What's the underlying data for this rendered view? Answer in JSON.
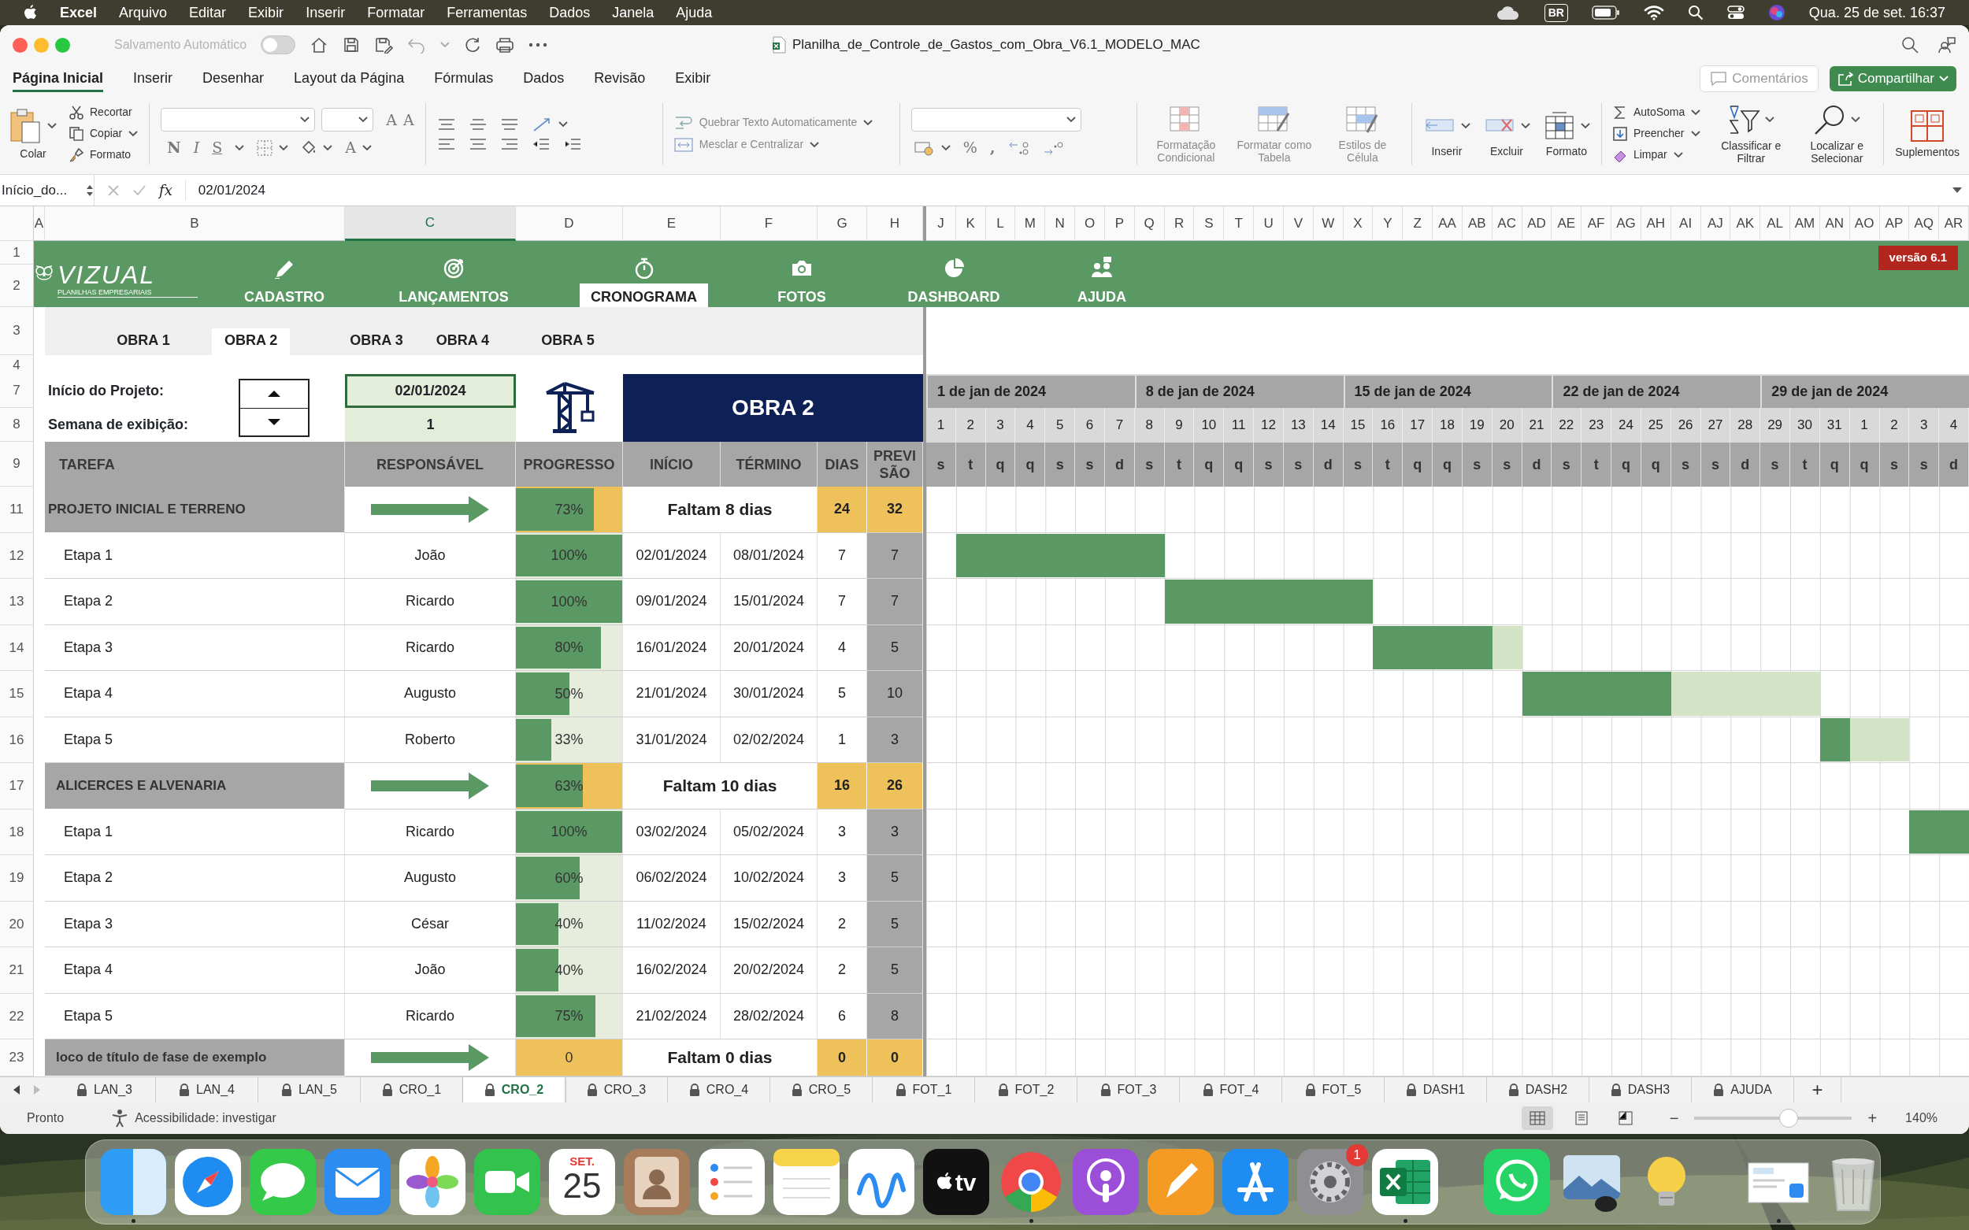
{
  "menu_bar": {
    "app": "Excel",
    "menus": [
      "Arquivo",
      "Editar",
      "Exibir",
      "Inserir",
      "Formatar",
      "Ferramentas",
      "Dados",
      "Janela",
      "Ajuda"
    ],
    "input_source": "BR",
    "clock": "Qua. 25 de set.  16:37"
  },
  "window": {
    "autosave_label": "Salvamento Automático",
    "autosave_on": false,
    "title": "Planilha_de_Controle_de_Gastos_com_Obra_V6.1_MODELO_MAC"
  },
  "ribbon_tabs": [
    {
      "label": "Página Inicial",
      "selected": true
    },
    {
      "label": "Inserir",
      "selected": false
    },
    {
      "label": "Desenhar",
      "selected": false
    },
    {
      "label": "Layout da Página",
      "selected": false
    },
    {
      "label": "Fórmulas",
      "selected": false
    },
    {
      "label": "Dados",
      "selected": false
    },
    {
      "label": "Revisão",
      "selected": false
    },
    {
      "label": "Exibir",
      "selected": false
    }
  ],
  "comments_button": "Comentários",
  "share_button": "Compartilhar",
  "ribbon": {
    "paste": "Colar",
    "cut": "Recortar",
    "copy": "Copiar",
    "format_painter": "Formato",
    "grow_font": "A",
    "shrink_font": "A",
    "bold": "N",
    "italic": "I",
    "underline": "S",
    "font_color": "A",
    "wrap_text": "Quebrar Texto Automaticamente",
    "merge": "Mesclar e Centralizar",
    "percent": "%",
    "comma": ",",
    "styles": [
      "Formatação Condicional",
      "Formatar como Tabela",
      "Estilos de Célula"
    ],
    "cells": [
      "Inserir",
      "Excluir",
      "Formato"
    ],
    "autosum": "AutoSoma",
    "fill": "Preencher",
    "clear": "Limpar",
    "sort": "Classificar e Filtrar",
    "find": "Localizar e Selecionar",
    "addins": "Suplementos"
  },
  "formula_bar": {
    "name_box": "Início_do...",
    "fx": "fx",
    "value": "02/01/2024"
  },
  "columns": [
    {
      "label": "A",
      "selected": false
    },
    {
      "label": "B",
      "selected": false
    },
    {
      "label": "C",
      "selected": true
    },
    {
      "label": "D",
      "selected": false
    },
    {
      "label": "E",
      "selected": false
    },
    {
      "label": "F",
      "selected": false
    },
    {
      "label": "G",
      "selected": false
    },
    {
      "label": "H",
      "selected": false
    },
    {
      "label": "J",
      "selected": false
    },
    {
      "label": "K",
      "selected": false
    },
    {
      "label": "L",
      "selected": false
    },
    {
      "label": "M",
      "selected": false
    },
    {
      "label": "N",
      "selected": false
    },
    {
      "label": "O",
      "selected": false
    },
    {
      "label": "P",
      "selected": false
    },
    {
      "label": "Q",
      "selected": false
    },
    {
      "label": "R",
      "selected": false
    },
    {
      "label": "S",
      "selected": false
    },
    {
      "label": "T",
      "selected": false
    },
    {
      "label": "U",
      "selected": false
    },
    {
      "label": "V",
      "selected": false
    },
    {
      "label": "W",
      "selected": false
    },
    {
      "label": "X",
      "selected": false
    },
    {
      "label": "Y",
      "selected": false
    },
    {
      "label": "Z",
      "selected": false
    },
    {
      "label": "AA",
      "selected": false
    },
    {
      "label": "AB",
      "selected": false
    },
    {
      "label": "AC",
      "selected": false
    },
    {
      "label": "AD",
      "selected": false
    },
    {
      "label": "AE",
      "selected": false
    },
    {
      "label": "AF",
      "selected": false
    },
    {
      "label": "AG",
      "selected": false
    },
    {
      "label": "AH",
      "selected": false
    },
    {
      "label": "AI",
      "selected": false
    },
    {
      "label": "AJ",
      "selected": false
    },
    {
      "label": "AK",
      "selected": false
    },
    {
      "label": "AL",
      "selected": false
    },
    {
      "label": "AM",
      "selected": false
    },
    {
      "label": "AN",
      "selected": false
    },
    {
      "label": "AO",
      "selected": false
    },
    {
      "label": "AP",
      "selected": false
    },
    {
      "label": "AQ",
      "selected": false
    },
    {
      "label": "AR",
      "selected": false
    }
  ],
  "row_numbers": [
    "1",
    "2",
    "3",
    "4",
    "7",
    "8",
    "9",
    "11",
    "12",
    "13",
    "14",
    "15",
    "16",
    "17",
    "18",
    "19",
    "20",
    "21",
    "22",
    "23"
  ],
  "nav": {
    "logo": "VIZUAL",
    "logo_sub": "PLANILHAS EMPRESARIAIS",
    "items": [
      {
        "label": "CADASTRO",
        "selected": false
      },
      {
        "label": "LANÇAMENTOS",
        "selected": false
      },
      {
        "label": "CRONOGRAMA",
        "selected": true
      },
      {
        "label": "FOTOS",
        "selected": false
      },
      {
        "label": "DASHBOARD",
        "selected": false
      },
      {
        "label": "AJUDA",
        "selected": false
      }
    ],
    "version": "versão 6.1"
  },
  "obra_tabs": [
    {
      "label": "OBRA 1",
      "selected": false
    },
    {
      "label": "OBRA 2",
      "selected": true
    },
    {
      "label": "OBRA 3",
      "selected": false
    },
    {
      "label": "OBRA 4",
      "selected": false
    },
    {
      "label": "OBRA 5",
      "selected": false
    }
  ],
  "project": {
    "start_label": "Início do Projeto:",
    "start": "02/01/2024",
    "week_label": "Semana de exibição:",
    "week": "1",
    "title": "OBRA 2"
  },
  "headers": [
    "TAREFA",
    "RESPONSÁVEL",
    "PROGRESSO",
    "INÍCIO",
    "TÉRMINO",
    "DIAS",
    "PREVISÃO"
  ],
  "timeline": {
    "weeks": [
      "1 de jan de 2024",
      "8 de jan de 2024",
      "15 de jan de 2024",
      "22 de jan de 2024",
      "29 de jan de 2024"
    ],
    "days": [
      "1",
      "2",
      "3",
      "4",
      "5",
      "6",
      "7",
      "8",
      "9",
      "10",
      "11",
      "12",
      "13",
      "14",
      "15",
      "16",
      "17",
      "18",
      "19",
      "20",
      "21",
      "22",
      "23",
      "24",
      "25",
      "26",
      "27",
      "28",
      "29",
      "30",
      "31",
      "1",
      "2",
      "3",
      "4"
    ],
    "weekdays": [
      "s",
      "t",
      "q",
      "q",
      "s",
      "s",
      "d",
      "s",
      "t",
      "q",
      "q",
      "s",
      "s",
      "d",
      "s",
      "t",
      "q",
      "q",
      "s",
      "s",
      "d",
      "s",
      "t",
      "q",
      "q",
      "s",
      "s",
      "d",
      "s",
      "t",
      "q",
      "q",
      "s",
      "s",
      "d"
    ]
  },
  "rows": [
    {
      "kind": "phase",
      "name": "PROJETO INICIAL E TERRENO",
      "level": 0.73,
      "progress": "73%",
      "remaining": "Faltam 8 dias",
      "days": "24",
      "forecast": "32"
    },
    {
      "kind": "task",
      "name": "Etapa 1",
      "owner": "João",
      "level": 1,
      "progress": "100%",
      "start": "02/01/2024",
      "end": "08/01/2024",
      "days": "7",
      "forecast": "7"
    },
    {
      "kind": "task",
      "name": "Etapa 2",
      "owner": "Ricardo",
      "level": 1,
      "progress": "100%",
      "start": "09/01/2024",
      "end": "15/01/2024",
      "days": "7",
      "forecast": "7"
    },
    {
      "kind": "task",
      "name": "Etapa 3",
      "owner": "Ricardo",
      "level": 0.8,
      "progress": "80%",
      "start": "16/01/2024",
      "end": "20/01/2024",
      "days": "4",
      "forecast": "5"
    },
    {
      "kind": "task",
      "name": "Etapa 4",
      "owner": "Augusto",
      "level": 0.5,
      "progress": "50%",
      "start": "21/01/2024",
      "end": "30/01/2024",
      "days": "5",
      "forecast": "10"
    },
    {
      "kind": "task",
      "name": "Etapa 5",
      "owner": "Roberto",
      "level": 0.33,
      "progress": "33%",
      "start": "31/01/2024",
      "end": "02/02/2024",
      "days": "1",
      "forecast": "3"
    },
    {
      "kind": "phase",
      "name": "ALICERCES E ALVENARIA",
      "level": 0.63,
      "progress": "63%",
      "remaining": "Faltam 10 dias",
      "days": "16",
      "forecast": "26"
    },
    {
      "kind": "task",
      "name": "Etapa 1",
      "owner": "Ricardo",
      "level": 1,
      "progress": "100%",
      "start": "03/02/2024",
      "end": "05/02/2024",
      "days": "3",
      "forecast": "3"
    },
    {
      "kind": "task",
      "name": "Etapa 2",
      "owner": "Augusto",
      "level": 0.6,
      "progress": "60%",
      "start": "06/02/2024",
      "end": "10/02/2024",
      "days": "3",
      "forecast": "5"
    },
    {
      "kind": "task",
      "name": "Etapa 3",
      "owner": "César",
      "level": 0.4,
      "progress": "40%",
      "start": "11/02/2024",
      "end": "15/02/2024",
      "days": "2",
      "forecast": "5"
    },
    {
      "kind": "task",
      "name": "Etapa 4",
      "owner": "João",
      "level": 0.4,
      "progress": "40%",
      "start": "16/02/2024",
      "end": "20/02/2024",
      "days": "2",
      "forecast": "5"
    },
    {
      "kind": "task",
      "name": "Etapa 5",
      "owner": "Ricardo",
      "level": 0.75,
      "progress": "75%",
      "start": "21/02/2024",
      "end": "28/02/2024",
      "days": "6",
      "forecast": "8"
    },
    {
      "kind": "phase",
      "name": "loco de título de fase de exemplo",
      "level": 0,
      "progress": "0",
      "remaining": "Faltam 0 dias",
      "days": "0",
      "forecast": "0"
    }
  ],
  "sheet_tabs": [
    {
      "label": "LAN_3",
      "selected": false
    },
    {
      "label": "LAN_4",
      "selected": false
    },
    {
      "label": "LAN_5",
      "selected": false
    },
    {
      "label": "CRO_1",
      "selected": false
    },
    {
      "label": "CRO_2",
      "selected": true
    },
    {
      "label": "CRO_3",
      "selected": false
    },
    {
      "label": "CRO_4",
      "selected": false
    },
    {
      "label": "CRO_5",
      "selected": false
    },
    {
      "label": "FOT_1",
      "selected": false
    },
    {
      "label": "FOT_2",
      "selected": false
    },
    {
      "label": "FOT_3",
      "selected": false
    },
    {
      "label": "FOT_4",
      "selected": false
    },
    {
      "label": "FOT_5",
      "selected": false
    },
    {
      "label": "DASH1",
      "selected": false
    },
    {
      "label": "DASH2",
      "selected": false
    },
    {
      "label": "DASH3",
      "selected": false
    },
    {
      "label": "AJUDA",
      "selected": false
    }
  ],
  "add_sheet": "+",
  "status_bar": {
    "ready": "Pronto",
    "accessibility": "Acessibilidade: investigar",
    "views": [
      {
        "kind": "normal",
        "selected": true
      },
      {
        "kind": "page_layout",
        "selected": false
      },
      {
        "kind": "page_break",
        "selected": false
      }
    ],
    "zoom_out": "−",
    "zoom_in": "+",
    "zoom": {
      "level": 0.6
    },
    "zoom_label": "140%"
  },
  "dock": {
    "apps": [
      {
        "kind": "finder",
        "running": true
      },
      {
        "kind": "safari",
        "running": false
      },
      {
        "kind": "messages",
        "running": false
      },
      {
        "kind": "mail",
        "running": false
      },
      {
        "kind": "photos",
        "running": false
      },
      {
        "kind": "facetime",
        "running": false
      },
      {
        "kind": "calendar",
        "running": false,
        "month": "SET.",
        "day": "25"
      },
      {
        "kind": "contacts",
        "running": false
      },
      {
        "kind": "reminders",
        "running": false
      },
      {
        "kind": "notes",
        "running": false
      },
      {
        "kind": "freeform",
        "running": false
      },
      {
        "kind": "tv",
        "running": false,
        "label": "tv"
      },
      {
        "kind": "chrome",
        "running": true
      },
      {
        "kind": "podcasts",
        "running": false
      },
      {
        "kind": "pages",
        "running": false
      },
      {
        "kind": "appstore",
        "running": false
      },
      {
        "kind": "settings",
        "running": false,
        "badge": "1"
      },
      {
        "kind": "excel",
        "running": true
      },
      {
        "kind": "separator"
      },
      {
        "kind": "whatsapp",
        "running": false
      },
      {
        "kind": "preview",
        "running": false
      },
      {
        "kind": "tips",
        "running": false
      },
      {
        "kind": "separator"
      },
      {
        "kind": "stack",
        "running": true
      },
      {
        "kind": "trash",
        "running": false
      }
    ]
  }
}
